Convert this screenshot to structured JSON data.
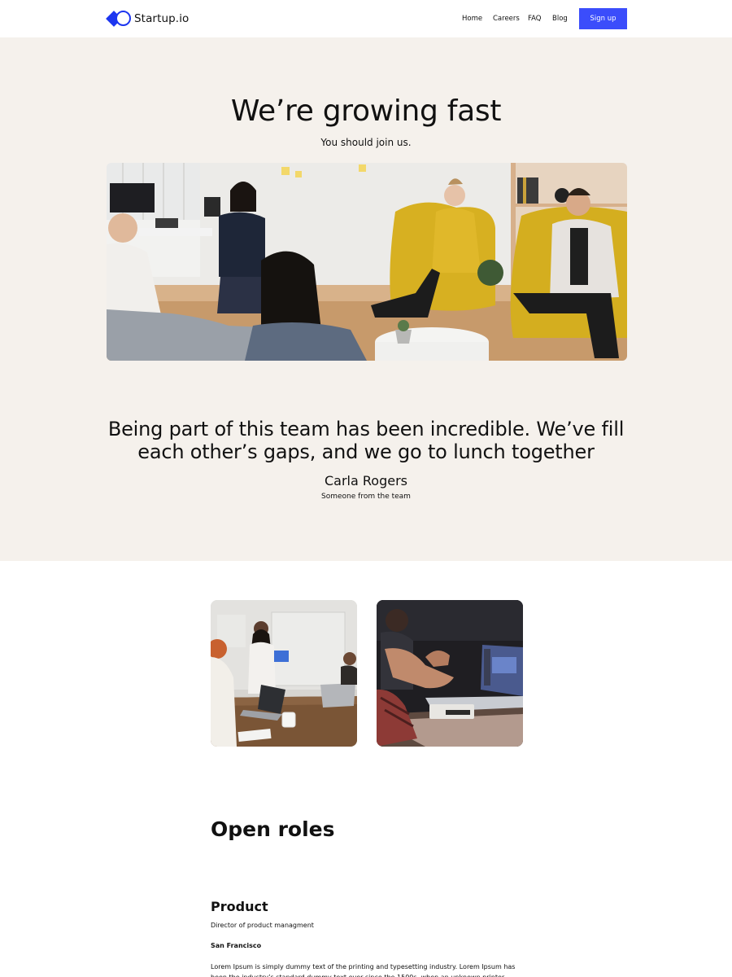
{
  "nav": {
    "brand": "Startup.io",
    "links": [
      "Home",
      "Careers",
      "FAQ",
      "Blog"
    ],
    "signup_label": "Sign up"
  },
  "hero": {
    "title": "We’re growing fast",
    "subtitle": "You should join us."
  },
  "testimonial": {
    "quote": "Being part of this team has been incredible. We’ve fill each other’s gaps, and we go to lunch together",
    "name": "Carla Rogers",
    "role": "Someone from the team"
  },
  "roles": {
    "title": "Open roles",
    "categories": [
      {
        "name": "Product",
        "jobs": [
          {
            "title": "Director of product managment",
            "location": "San Francisco",
            "description": "Lorem Ipsum is simply dummy text of the printing and typesetting industry. Lorem Ipsum has been the industry’s standard dummy text ever since the 1500s, when an unknown printer took a galley of type and"
          }
        ]
      }
    ]
  },
  "colors": {
    "accent": "#3b4dfb",
    "logo": "#1d36f0",
    "hero_bg": "#f5f1ec"
  }
}
